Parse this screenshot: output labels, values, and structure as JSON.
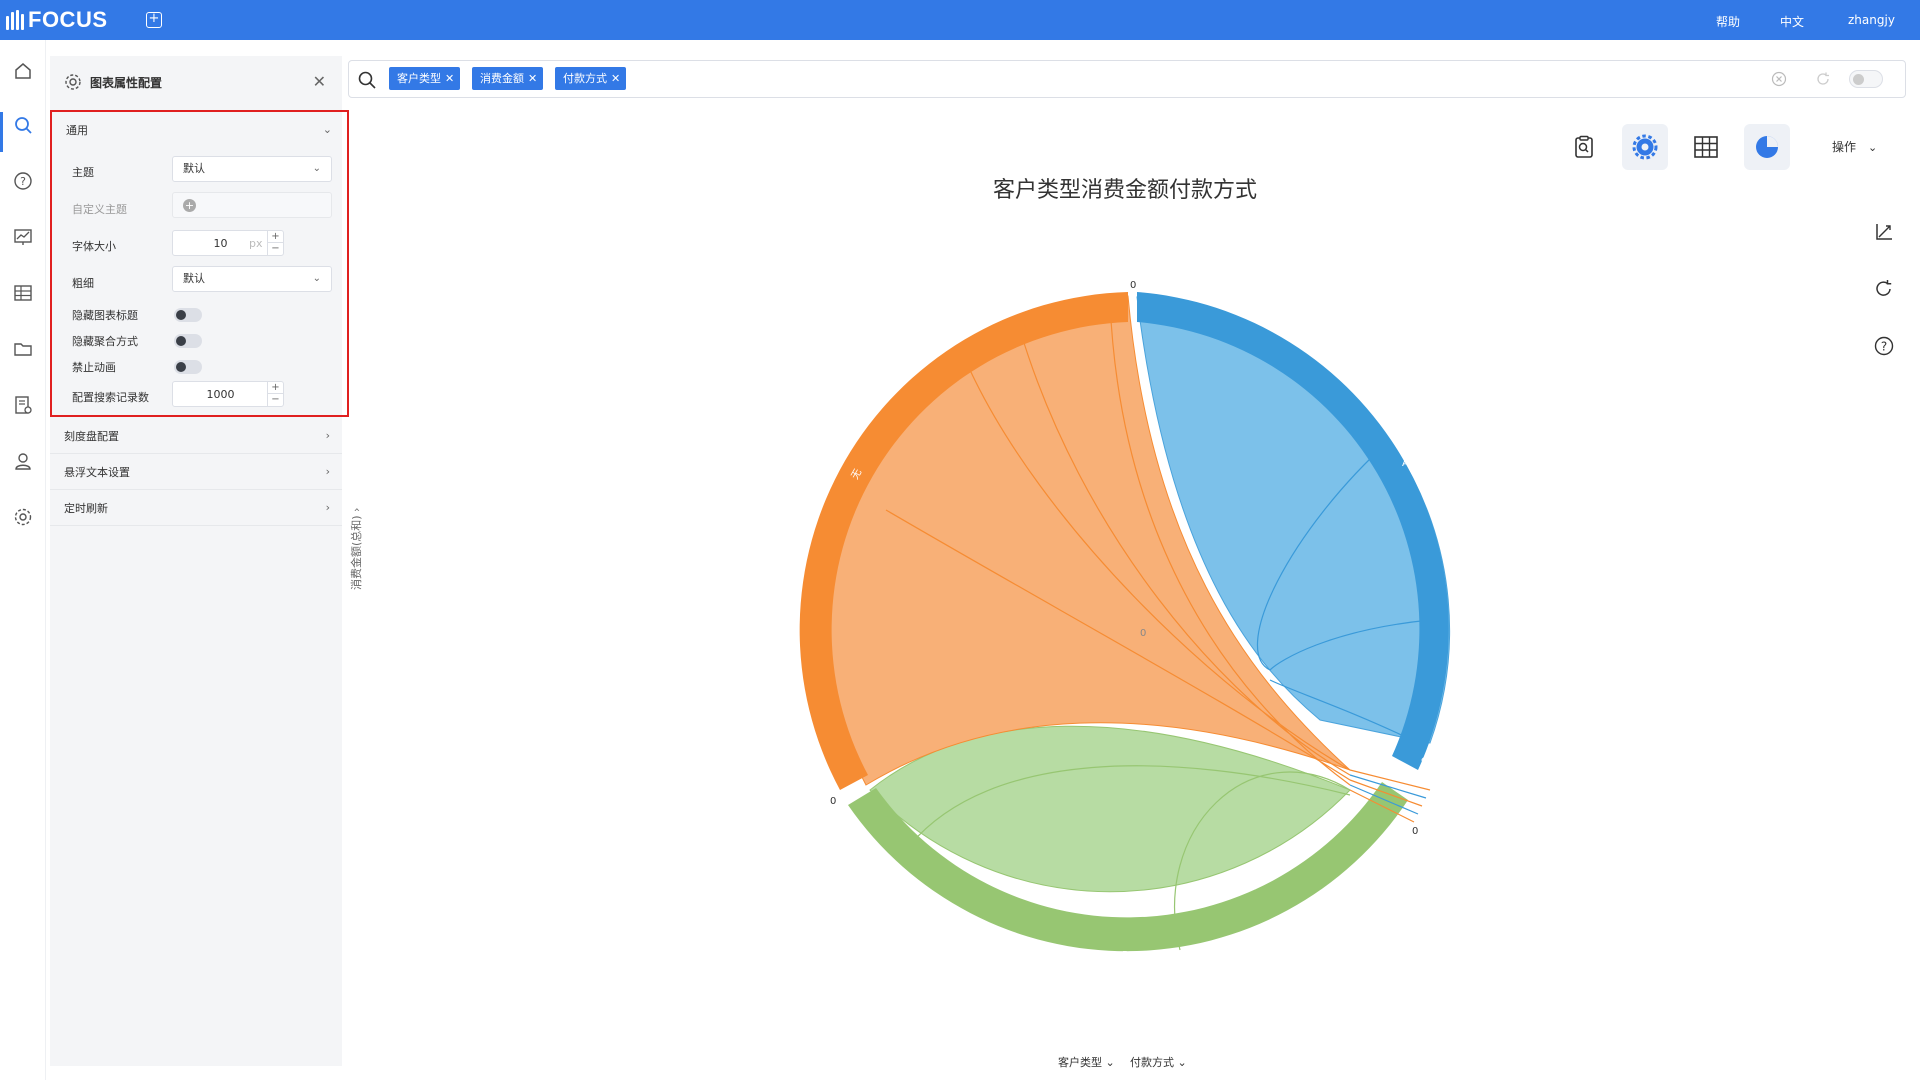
{
  "app": {
    "brand": "FOCUS"
  },
  "header": {
    "help": "帮助",
    "lang": "中文",
    "user": "zhangjy"
  },
  "rail": {
    "icons": [
      "home-icon",
      "search-icon",
      "help-icon",
      "dashboard-icon",
      "table-icon",
      "folder-icon",
      "report-settings-icon",
      "user-icon",
      "settings-icon"
    ]
  },
  "panel": {
    "title": "图表属性配置",
    "general": {
      "label": "通用",
      "theme_label": "主题",
      "theme_value": "默认",
      "custom_theme_label": "自定义主题",
      "font_size_label": "字体大小",
      "font_size_value": "10",
      "font_size_unit": "px",
      "weight_label": "粗细",
      "weight_value": "默认",
      "hide_title_label": "隐藏图表标题",
      "hide_agg_label": "隐藏聚合方式",
      "disable_anim_label": "禁止动画",
      "records_label": "配置搜索记录数",
      "records_value": "1000"
    },
    "sections": [
      "刻度盘配置",
      "悬浮文本设置",
      "定时刷新"
    ]
  },
  "search": {
    "chips": [
      "客户类型",
      "消费金额",
      "付款方式"
    ]
  },
  "toolbar": {
    "ops_label": "操作"
  },
  "chart": {
    "title": "客户类型消费金额付款方式",
    "ylabel": "消费金额(总和)",
    "x_fields": [
      "客户类型",
      "付款方式"
    ]
  },
  "chart_data": {
    "type": "chord",
    "title": "客户类型消费金额付款方式",
    "groups": [
      {
        "name": "A",
        "color": "#3a9ad9"
      },
      {
        "name": "B",
        "color": "#97c672"
      },
      {
        "name": "无",
        "color": "#f68c33"
      }
    ],
    "node_labels": [
      "A",
      "B",
      "无",
      "0",
      "0",
      "0",
      "0",
      "0"
    ],
    "colors": {
      "accent": "#3379e6",
      "highlight_border": "#e02020"
    }
  }
}
